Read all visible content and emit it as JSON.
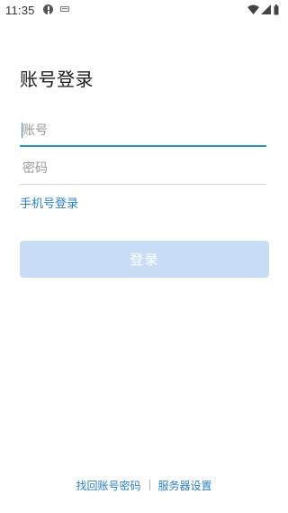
{
  "status_bar": {
    "time": "11:35",
    "icons": [
      "alert-icon",
      "keyboard-icon",
      "wifi-icon",
      "signal-icon",
      "battery-icon"
    ]
  },
  "login": {
    "title": "账号登录",
    "account_placeholder": "账号",
    "account_value": "",
    "password_placeholder": "密码",
    "password_value": "",
    "phone_login_label": "手机号登录",
    "login_button_label": "登录"
  },
  "footer": {
    "recover_label": "找回账号密码",
    "server_settings_label": "服务器设置"
  },
  "colors": {
    "accent": "#2196c6",
    "link": "#2a7fc4",
    "button_disabled": "#c9def6"
  }
}
